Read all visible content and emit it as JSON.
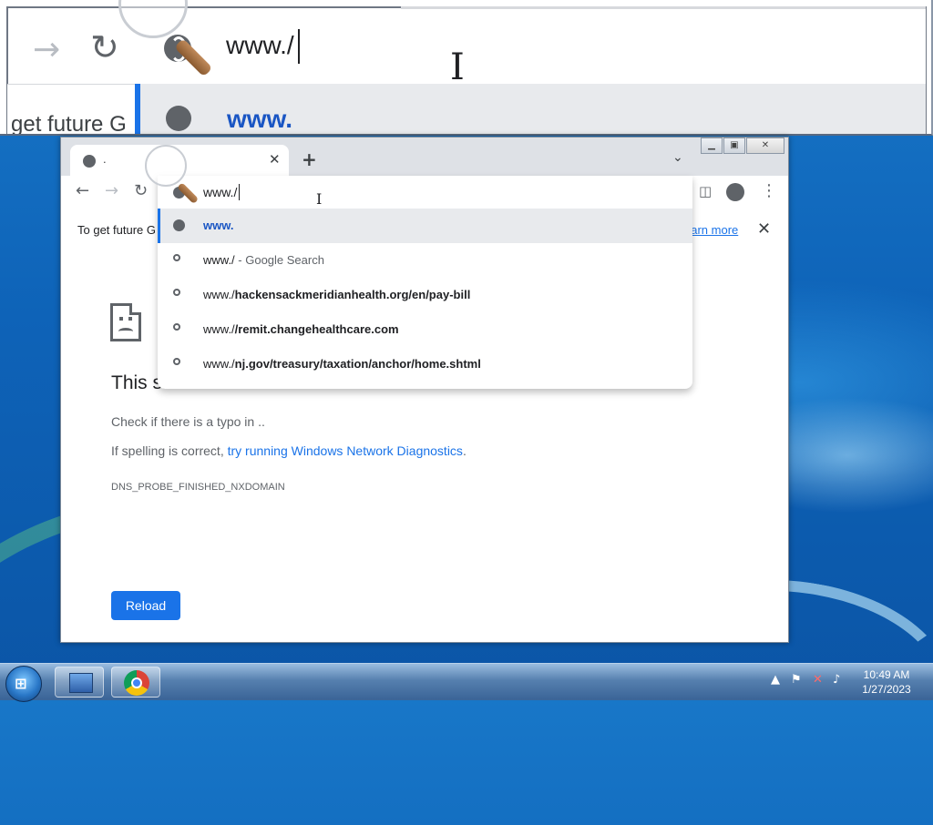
{
  "magnifier": {
    "omnibox_text": "www./",
    "suggestion_text": "www.",
    "infobar_fragment": "get future G"
  },
  "window": {
    "tab": {
      "title": "."
    },
    "omnibox": {
      "text": "www./"
    },
    "infobar": {
      "message": "To get future G",
      "learn_more": "earn more"
    },
    "suggestions": [
      {
        "type": "url",
        "icon": "globe-icon",
        "text": "www."
      },
      {
        "type": "search",
        "icon": "search-icon",
        "prefix": "www./",
        "suffix": " - Google Search"
      },
      {
        "type": "history",
        "icon": "search-icon",
        "prefix": "www./",
        "bold": "hackensackmeridianhealth.org/en/pay-bill"
      },
      {
        "type": "history",
        "icon": "search-icon",
        "prefix": "www./",
        "bold": "/remit.changehealthcare.com"
      },
      {
        "type": "history",
        "icon": "search-icon",
        "prefix": "www./",
        "bold": "nj.gov/treasury/taxation/anchor/home.shtml"
      }
    ],
    "error": {
      "title": "This site can’t be reached",
      "line1": "Check if there is a typo in ..",
      "line2_prefix": "If spelling is correct, ",
      "line2_link": "try running Windows Network Diagnostics",
      "line2_suffix": ".",
      "code": "DNS_PROBE_FINISHED_NXDOMAIN",
      "reload": "Reload"
    }
  },
  "taskbar": {
    "clock_time": "10:49 AM",
    "clock_date": "1/27/2023"
  },
  "colors": {
    "accent": "#1a73e8",
    "link_bold": "#1a56c4",
    "desktop": "#0e63b8"
  }
}
